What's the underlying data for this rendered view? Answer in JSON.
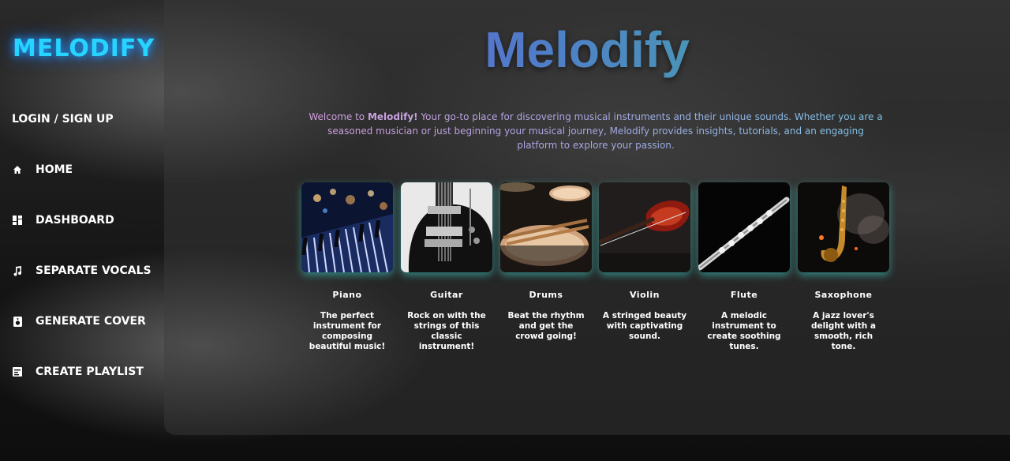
{
  "sidebar": {
    "brand": "MELODIFY",
    "login": "LOGIN / SIGN UP",
    "items": [
      {
        "label": "HOME",
        "icon": "home-icon"
      },
      {
        "label": "DASHBOARD",
        "icon": "dashboard-icon"
      },
      {
        "label": "SEPARATE VOCALS",
        "icon": "music-note-icon"
      },
      {
        "label": "GENERATE COVER",
        "icon": "speaker-icon"
      },
      {
        "label": "CREATE PLAYLIST",
        "icon": "playlist-icon"
      }
    ]
  },
  "main": {
    "title": "Melodify",
    "welcome_pre": "Welcome to ",
    "welcome_brand": "Melodify!",
    "welcome_post": " Your go-to place for discovering musical instruments and their unique sounds. Whether you are a seasoned musician or just beginning your musical journey, Melodify provides insights, tutorials, and an engaging platform to explore your passion.",
    "instruments": [
      {
        "name": "Piano",
        "desc": "The perfect instrument for composing beautiful music!"
      },
      {
        "name": "Guitar",
        "desc": "Rock on with the strings of this classic instrument!"
      },
      {
        "name": "Drums",
        "desc": "Beat the rhythm and get the crowd going!"
      },
      {
        "name": "Violin",
        "desc": "A stringed beauty with captivating sound."
      },
      {
        "name": "Flute",
        "desc": "A melodic instrument to create soothing tunes."
      },
      {
        "name": "Saxophone",
        "desc": "A jazz lover's delight with a smooth, rich tone."
      }
    ]
  },
  "colors": {
    "brand_glow": "#27d3ff",
    "card_glow": "#3cd2c8",
    "title_gradient_start": "#6b4fd8",
    "title_gradient_end": "#3fc48e"
  }
}
